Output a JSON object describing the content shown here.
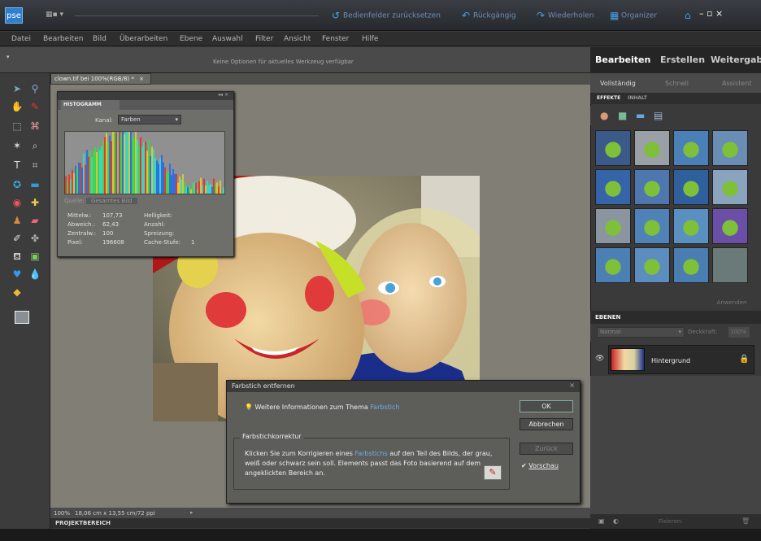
{
  "app": {
    "logo": "pse",
    "layout_icon": "▦▪ ▾"
  },
  "titlebar": {
    "actions": [
      {
        "icon": "reset-icon",
        "glyph": "↺",
        "label": "Bedienfelder zurücksetzen"
      },
      {
        "icon": "undo-icon",
        "glyph": "↶",
        "label": "Rückgängig"
      },
      {
        "icon": "redo-icon",
        "glyph": "↷",
        "label": "Wiederholen"
      },
      {
        "icon": "organizer-icon",
        "glyph": "▦",
        "label": "Organizer"
      },
      {
        "icon": "home-icon",
        "glyph": "⌂",
        "label": ""
      }
    ],
    "window_controls": "–  ▫  ×"
  },
  "menu": [
    "Datei",
    "Bearbeiten",
    "Bild",
    "Überarbeiten",
    "Ebene",
    "Auswahl",
    "Filter",
    "Ansicht",
    "Fenster",
    "Hilfe"
  ],
  "options_bar": {
    "text": "Keine Optionen für aktuelles Werkzeug verfügbar"
  },
  "document": {
    "tab_label": "clown.tif bei 100%(RGB/8) *",
    "close": "×"
  },
  "status": {
    "zoom": "100%",
    "info": "18,06 cm x 13,55 cm/72 ppi"
  },
  "project_bin": {
    "label": "PROJEKTBEREICH"
  },
  "histogram": {
    "title": "HISTOGRAMM",
    "channel_label": "Kanal:",
    "channel_value": "Farben",
    "source_label": "Quelle:",
    "source_value": "Gesamtes Bild",
    "stats_left": [
      {
        "label": "Mittelw.:",
        "value": "107,73"
      },
      {
        "label": "Abweich.:",
        "value": "62,43"
      },
      {
        "label": "Zentralw.:",
        "value": "100"
      },
      {
        "label": "Pixel:",
        "value": "196608"
      }
    ],
    "stats_right": [
      {
        "label": "Helligkeit:",
        "value": ""
      },
      {
        "label": "Anzahl:",
        "value": ""
      },
      {
        "label": "Spreizung:",
        "value": ""
      },
      {
        "label": "Cache-Stufe:",
        "value": "1"
      }
    ]
  },
  "panel": {
    "tabs": [
      "Bearbeiten",
      "Erstellen",
      "Weitergabe"
    ],
    "subtabs": [
      "Vollständig",
      "Schnell",
      "Assistent"
    ],
    "effects_tabs": [
      "EFFEKTE",
      "INHALT"
    ],
    "apply_label": "Anwenden",
    "layers_title": "EBENEN",
    "blend_mode": "Normal",
    "opacity_label": "Deckkraft:",
    "opacity_value": "100%",
    "layer_name": "Hintergrund",
    "bottom_label": "Fixieren:"
  },
  "dialog": {
    "title": "Farbstich entfernen",
    "info_text": "Weitere Informationen zum Thema",
    "info_link": "Farbstich",
    "group_title": "Farbstichkorrektur",
    "instruction_before": "Klicken Sie zum Korrigieren eines",
    "instruction_link": "Farbstichs",
    "instruction_after": "auf den Teil des Bilds, der grau, weiß oder schwarz sein soll. Elements passt das Foto basierend auf dem angeklickten Bereich an.",
    "ok": "OK",
    "cancel": "Abbrechen",
    "reset": "Zurück",
    "preview_label": "Vorschau",
    "preview_checked": true
  }
}
